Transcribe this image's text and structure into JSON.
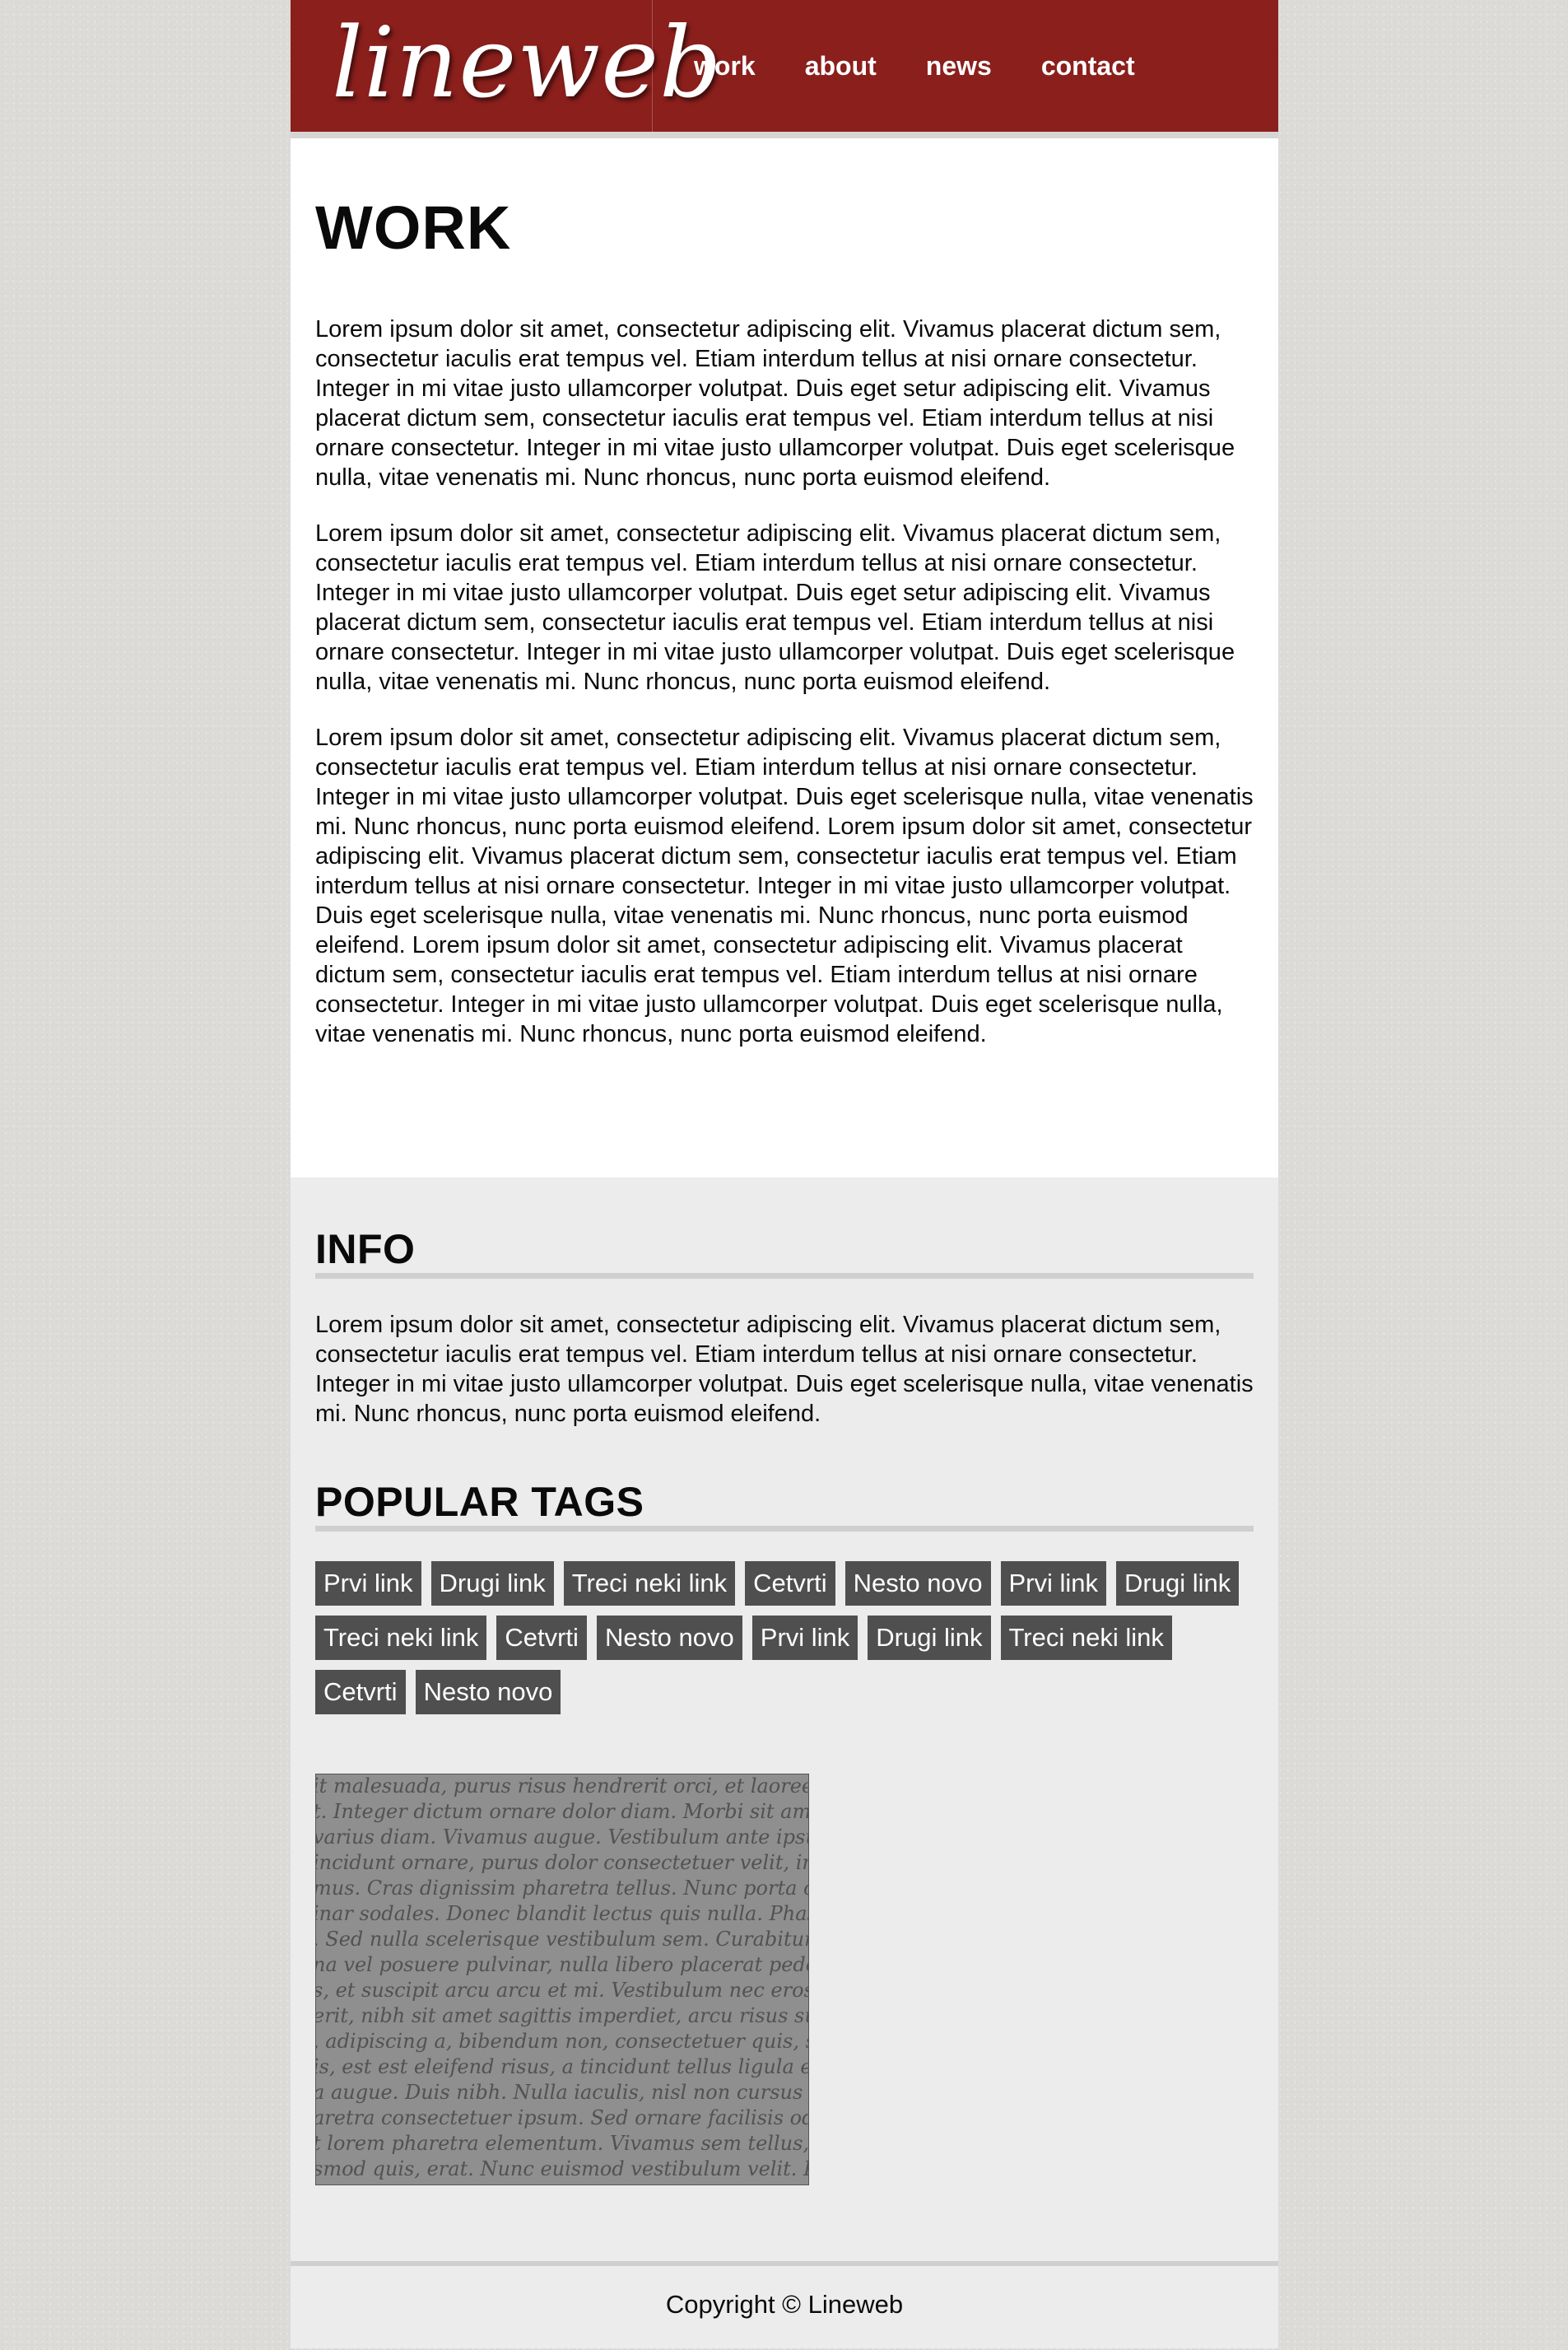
{
  "header": {
    "logo": "lineweb",
    "nav": [
      "work",
      "about",
      "news",
      "contact"
    ]
  },
  "main": {
    "title": "WORK",
    "paragraphs": [
      "Lorem ipsum dolor sit amet, consectetur adipiscing elit. Vivamus placerat dictum sem, consectetur iaculis erat tempus vel. Etiam interdum tellus at nisi ornare consectetur. Integer in mi vitae justo ullamcorper volutpat. Duis eget setur adipiscing elit. Vivamus placerat dictum sem, consectetur iaculis erat tempus vel. Etiam interdum tellus at nisi ornare consectetur. Integer in mi vitae justo ullamcorper volutpat. Duis eget scelerisque nulla, vitae venenatis mi. Nunc rhoncus, nunc porta euismod eleifend.",
      "Lorem ipsum dolor sit amet, consectetur adipiscing elit. Vivamus placerat dictum sem, consectetur iaculis erat tempus vel. Etiam interdum tellus at nisi ornare consectetur. Integer in mi vitae justo ullamcorper volutpat. Duis eget setur adipiscing elit. Vivamus placerat dictum sem, consectetur iaculis erat tempus vel. Etiam interdum tellus at nisi ornare consectetur. Integer in mi vitae justo ullamcorper volutpat. Duis eget scelerisque nulla, vitae venenatis mi. Nunc rhoncus, nunc porta euismod eleifend.",
      "Lorem ipsum dolor sit amet, consectetur adipiscing elit. Vivamus placerat dictum sem, consectetur iaculis erat tempus vel. Etiam interdum tellus at nisi ornare consectetur. Integer in mi vitae justo ullamcorper volutpat. Duis eget scelerisque nulla, vitae venenatis mi. Nunc rhoncus, nunc porta euismod eleifend. Lorem ipsum dolor sit amet, consectetur adipiscing elit. Vivamus placerat dictum sem, consectetur iaculis erat tempus vel. Etiam interdum tellus at nisi ornare consectetur. Integer in mi vitae justo ullamcorper volutpat. Duis eget scelerisque nulla, vitae venenatis mi. Nunc rhoncus, nunc porta euismod eleifend. Lorem ipsum dolor sit amet, consectetur adipiscing elit. Vivamus placerat dictum sem, consectetur iaculis erat tempus vel. Etiam interdum tellus at nisi ornare consectetur. Integer in mi vitae justo ullamcorper volutpat. Duis eget scelerisque nulla, vitae venenatis mi. Nunc rhoncus, nunc porta euismod eleifend."
    ]
  },
  "sidebar": {
    "info_title": "INFO",
    "info_text": "Lorem ipsum dolor sit amet, consectetur adipiscing elit. Vivamus placerat dictum sem, consectetur iaculis erat tempus vel. Etiam interdum tellus at nisi ornare consectetur. Integer in mi vitae justo ullamcorper volutpat. Duis eget scelerisque nulla, vitae venenatis mi. Nunc rhoncus, nunc porta euismod eleifend.",
    "tags_title": "POPULAR TAGS",
    "tags": [
      "Prvi link",
      "Drugi link",
      "Treci neki link",
      "Cetvrti",
      "Nesto novo",
      "Prvi link",
      "Drugi link",
      "Treci neki link",
      "Cetvrti",
      "Nesto novo",
      "Prvi link",
      "Drugi link",
      "Treci neki link",
      "Cetvrti",
      "Nesto novo"
    ],
    "image_lines": [
      "it malesuada, purus risus hendrerit orci, et laoreet pede e",
      "t. Integer dictum ornare dolor diam. Morbi sit amet arcu",
      "varius diam. Vivamus augue. Vestibulum ante ipsum pe",
      "incidunt ornare, purus dolor consectetuer velit, in euism",
      "mus. Cras dignissim pharetra tellus. Nunc porta commod",
      "inar sodales. Donec blandit lectus quis nulla. Phasellus d",
      ". Sed nulla scelerisque vestibulum sem. Curabitur libero",
      "na vel posuere pulvinar, nulla libero placerat pede, at co",
      "s, et suscipit arcu arcu et mi. Vestibulum nec eros dictum",
      "erit, nibh sit amet sagittis imperdiet, arcu risus suscipit",
      ", adipiscing a, bibendum non, consectetuer quis, sem. Pro",
      "is, est est eleifend risus, a tincidunt tellus ligula et lectus",
      "a augue. Duis nibh. Nulla iaculis, nisl non cursus iaculis",
      "aretra consectetuer ipsum. Sed ornare facilisis odio. Cum",
      "t lorem pharetra elementum. Vivamus sem tellus, digniss",
      "smod quis, erat. Nunc euismod vestibulum velit. Proin u"
    ]
  },
  "footer": {
    "copyright": "Copyright © Lineweb"
  },
  "colors": {
    "header_bg": "#8a1f1c",
    "tag_bg": "#4f4f4f",
    "sidebar_bg": "#ececec"
  }
}
